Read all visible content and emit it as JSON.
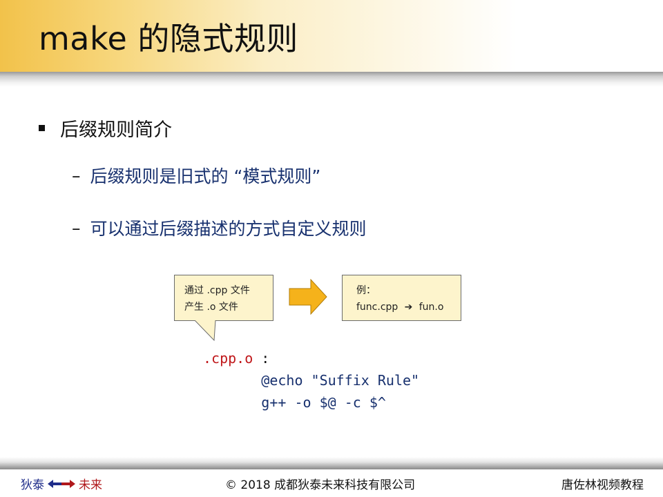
{
  "title": "make 的隐式规则",
  "bullet": "后缀规则简介",
  "subs": [
    "后缀规则是旧式的 “模式规则”",
    "可以通过后缀描述的方式自定义规则"
  ],
  "callout": {
    "line1": "通过 .cpp 文件",
    "line2": "产生 .o 文件"
  },
  "example": {
    "label": "例：",
    "from": "func.cpp",
    "to": "fun.o"
  },
  "code": {
    "target": ".cpp.o",
    "colon": ":",
    "line1": "@echo \"Suffix Rule\"",
    "line2": "g++ -o $@ -c $^"
  },
  "footer": {
    "left_a": "狄泰",
    "left_b": "未来",
    "center": "© 2018 成都狄泰未来科技有限公司",
    "right": "唐佐林视频教程"
  },
  "colors": {
    "header": "#f2c24a",
    "note_bg": "#fdf4cc",
    "arrow": "#f5b21b",
    "code_target": "#c0181b",
    "code_text": "#17306e"
  }
}
